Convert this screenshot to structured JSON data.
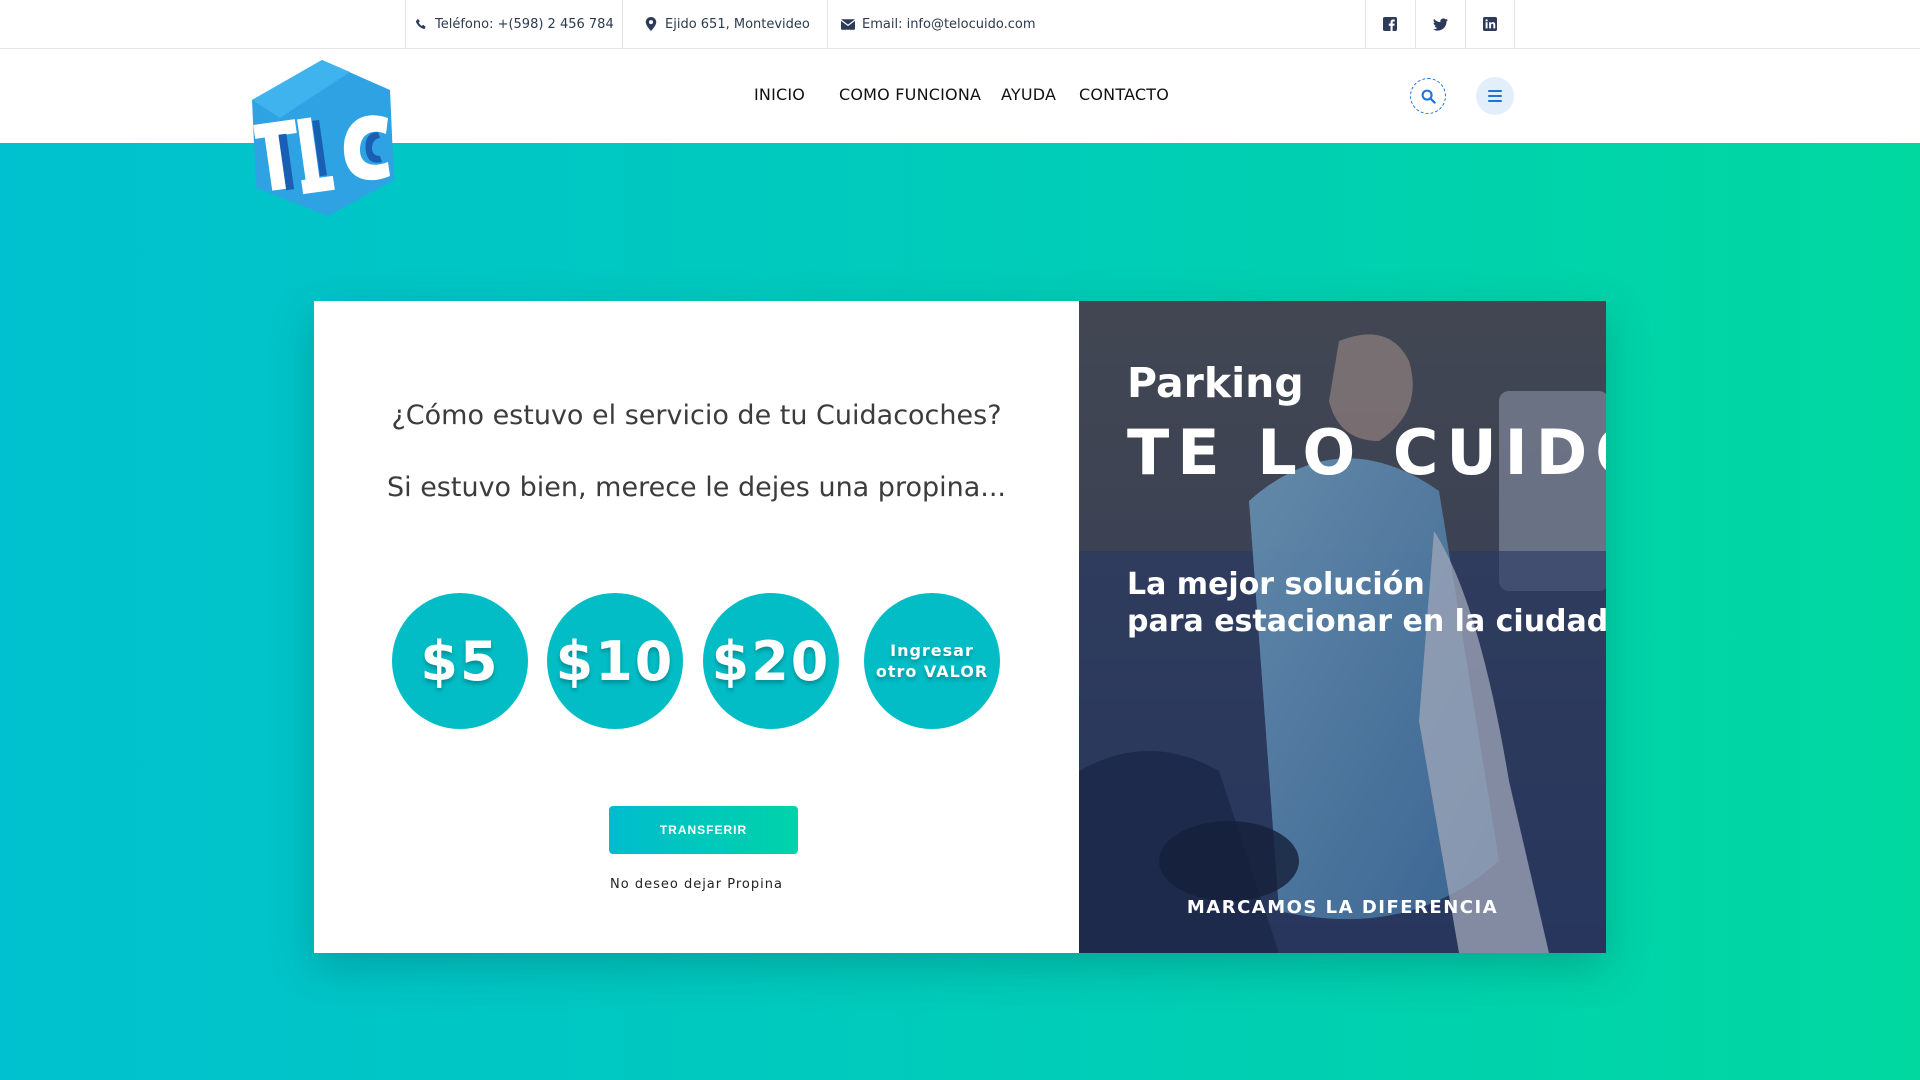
{
  "topbar": {
    "phone": "Teléfono: +(598) 2 456 784",
    "address": "Ejido 651, Montevideo",
    "email": "Email: info@telocuido.com",
    "social": [
      "facebook-icon",
      "twitter-icon",
      "linkedin-icon"
    ]
  },
  "nav": {
    "items": [
      {
        "label": "INICIO"
      },
      {
        "label": "COMO FUNCIONA"
      },
      {
        "label": "AYUDA"
      },
      {
        "label": "CONTACTO"
      }
    ]
  },
  "logo": {
    "text": "TLC"
  },
  "colors": {
    "accent": "#02bdc6",
    "gradient_start": "#00c1cf",
    "gradient_end": "#00d8a0",
    "nav_accent": "#1e73d8"
  },
  "tip_panel": {
    "question": "¿Cómo estuvo el servicio de tu Cuidacoches?",
    "prompt": "Si estuvo bien, merece le dejes una propina...",
    "amounts": [
      {
        "label": "$5"
      },
      {
        "label": "$10"
      },
      {
        "label": "$20"
      }
    ],
    "other_line1": "Ingresar",
    "other_line2": "otro VALOR",
    "transfer_label": "TRANSFERIR",
    "no_tip_label": "No deseo dejar Propina"
  },
  "promo": {
    "parking": "Parking",
    "brand": "TE LO CUIDO",
    "tagline_line1": "La mejor solución",
    "tagline_line2": "para estacionar en la ciudad",
    "footer": "MARCAMOS LA DIFERENCIA"
  }
}
